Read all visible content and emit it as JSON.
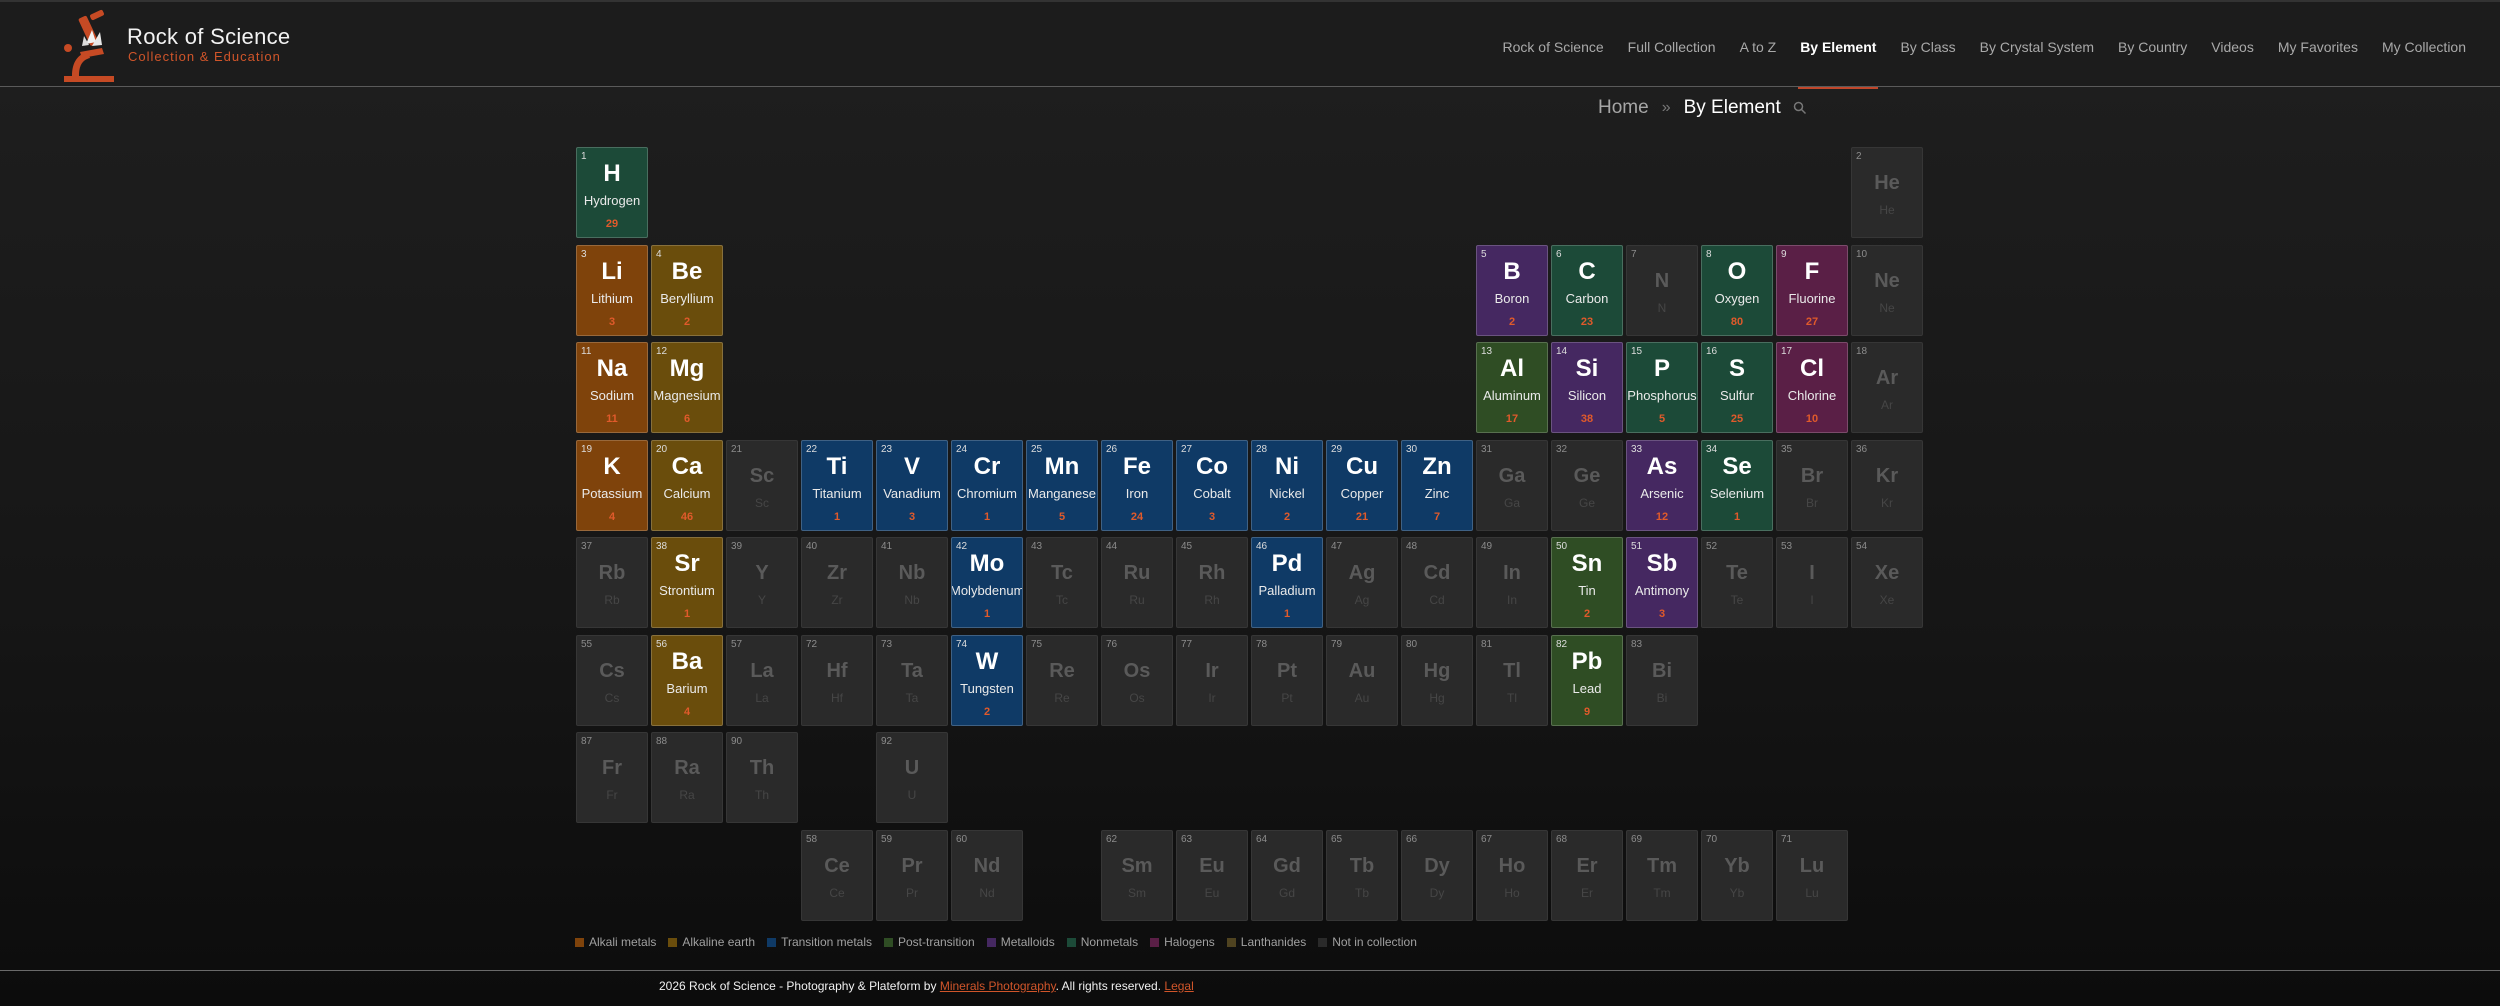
{
  "header": {
    "logo_title": "Rock of Science",
    "logo_subtitle": "Collection & Education",
    "logo_icon": "microscope-crystal-icon",
    "accent_color": "#d0552a",
    "nav": [
      {
        "label": "Rock of Science",
        "active": false
      },
      {
        "label": "Full Collection",
        "active": false
      },
      {
        "label": "A to Z",
        "active": false
      },
      {
        "label": "By Element",
        "active": true
      },
      {
        "label": "By Class",
        "active": false
      },
      {
        "label": "By Crystal System",
        "active": false
      },
      {
        "label": "By Country",
        "active": false
      },
      {
        "label": "Videos",
        "active": false
      },
      {
        "label": "My Favorites",
        "active": false
      },
      {
        "label": "My Collection",
        "active": false
      }
    ]
  },
  "breadcrumb": {
    "home": "Home",
    "separator": "»",
    "current": "By Element",
    "search_icon": "search-icon"
  },
  "category_colors": {
    "alkali": "#7f430b",
    "alkaline": "#6a4d0c",
    "transition": "#0f3a66",
    "post": "#2f4d24",
    "metalloid": "#452861",
    "nonmetal": "#1c4a38",
    "halogen": "#5a1f46",
    "lanth": "#4f4320",
    "none": "#2a2a2a"
  },
  "elements": [
    {
      "num": "1",
      "sym": "H",
      "name": "Hydrogen",
      "count": "29",
      "cat": "nonmetal"
    },
    {
      "num": "2",
      "sym": "He",
      "name": "He",
      "count": "",
      "cat": "none"
    },
    {
      "num": "3",
      "sym": "Li",
      "name": "Lithium",
      "count": "3",
      "cat": "alkali"
    },
    {
      "num": "4",
      "sym": "Be",
      "name": "Beryllium",
      "count": "2",
      "cat": "alkaline"
    },
    {
      "num": "5",
      "sym": "B",
      "name": "Boron",
      "count": "2",
      "cat": "metalloid"
    },
    {
      "num": "6",
      "sym": "C",
      "name": "Carbon",
      "count": "23",
      "cat": "nonmetal"
    },
    {
      "num": "7",
      "sym": "N",
      "name": "N",
      "count": "",
      "cat": "none"
    },
    {
      "num": "8",
      "sym": "O",
      "name": "Oxygen",
      "count": "80",
      "cat": "nonmetal"
    },
    {
      "num": "9",
      "sym": "F",
      "name": "Fluorine",
      "count": "27",
      "cat": "halogen"
    },
    {
      "num": "10",
      "sym": "Ne",
      "name": "Ne",
      "count": "",
      "cat": "none"
    },
    {
      "num": "11",
      "sym": "Na",
      "name": "Sodium",
      "count": "11",
      "cat": "alkali"
    },
    {
      "num": "12",
      "sym": "Mg",
      "name": "Magnesium",
      "count": "6",
      "cat": "alkaline"
    },
    {
      "num": "13",
      "sym": "Al",
      "name": "Aluminum",
      "count": "17",
      "cat": "post"
    },
    {
      "num": "14",
      "sym": "Si",
      "name": "Silicon",
      "count": "38",
      "cat": "metalloid"
    },
    {
      "num": "15",
      "sym": "P",
      "name": "Phosphorus",
      "count": "5",
      "cat": "nonmetal"
    },
    {
      "num": "16",
      "sym": "S",
      "name": "Sulfur",
      "count": "25",
      "cat": "nonmetal"
    },
    {
      "num": "17",
      "sym": "Cl",
      "name": "Chlorine",
      "count": "10",
      "cat": "halogen"
    },
    {
      "num": "18",
      "sym": "Ar",
      "name": "Ar",
      "count": "",
      "cat": "none"
    },
    {
      "num": "19",
      "sym": "K",
      "name": "Potassium",
      "count": "4",
      "cat": "alkali"
    },
    {
      "num": "20",
      "sym": "Ca",
      "name": "Calcium",
      "count": "46",
      "cat": "alkaline"
    },
    {
      "num": "21",
      "sym": "Sc",
      "name": "Sc",
      "count": "",
      "cat": "none"
    },
    {
      "num": "22",
      "sym": "Ti",
      "name": "Titanium",
      "count": "1",
      "cat": "transition"
    },
    {
      "num": "23",
      "sym": "V",
      "name": "Vanadium",
      "count": "3",
      "cat": "transition"
    },
    {
      "num": "24",
      "sym": "Cr",
      "name": "Chromium",
      "count": "1",
      "cat": "transition"
    },
    {
      "num": "25",
      "sym": "Mn",
      "name": "Manganese",
      "count": "5",
      "cat": "transition"
    },
    {
      "num": "26",
      "sym": "Fe",
      "name": "Iron",
      "count": "24",
      "cat": "transition"
    },
    {
      "num": "27",
      "sym": "Co",
      "name": "Cobalt",
      "count": "3",
      "cat": "transition"
    },
    {
      "num": "28",
      "sym": "Ni",
      "name": "Nickel",
      "count": "2",
      "cat": "transition"
    },
    {
      "num": "29",
      "sym": "Cu",
      "name": "Copper",
      "count": "21",
      "cat": "transition"
    },
    {
      "num": "30",
      "sym": "Zn",
      "name": "Zinc",
      "count": "7",
      "cat": "transition"
    },
    {
      "num": "31",
      "sym": "Ga",
      "name": "Ga",
      "count": "",
      "cat": "none"
    },
    {
      "num": "32",
      "sym": "Ge",
      "name": "Ge",
      "count": "",
      "cat": "none"
    },
    {
      "num": "33",
      "sym": "As",
      "name": "Arsenic",
      "count": "12",
      "cat": "metalloid"
    },
    {
      "num": "34",
      "sym": "Se",
      "name": "Selenium",
      "count": "1",
      "cat": "nonmetal"
    },
    {
      "num": "35",
      "sym": "Br",
      "name": "Br",
      "count": "",
      "cat": "none"
    },
    {
      "num": "36",
      "sym": "Kr",
      "name": "Kr",
      "count": "",
      "cat": "none"
    },
    {
      "num": "37",
      "sym": "Rb",
      "name": "Rb",
      "count": "",
      "cat": "none"
    },
    {
      "num": "38",
      "sym": "Sr",
      "name": "Strontium",
      "count": "1",
      "cat": "alkaline"
    },
    {
      "num": "39",
      "sym": "Y",
      "name": "Y",
      "count": "",
      "cat": "none"
    },
    {
      "num": "40",
      "sym": "Zr",
      "name": "Zr",
      "count": "",
      "cat": "none"
    },
    {
      "num": "41",
      "sym": "Nb",
      "name": "Nb",
      "count": "",
      "cat": "none"
    },
    {
      "num": "42",
      "sym": "Mo",
      "name": "Molybdenum",
      "count": "1",
      "cat": "transition"
    },
    {
      "num": "43",
      "sym": "Tc",
      "name": "Tc",
      "count": "",
      "cat": "none"
    },
    {
      "num": "44",
      "sym": "Ru",
      "name": "Ru",
      "count": "",
      "cat": "none"
    },
    {
      "num": "45",
      "sym": "Rh",
      "name": "Rh",
      "count": "",
      "cat": "none"
    },
    {
      "num": "46",
      "sym": "Pd",
      "name": "Palladium",
      "count": "1",
      "cat": "transition"
    },
    {
      "num": "47",
      "sym": "Ag",
      "name": "Ag",
      "count": "",
      "cat": "none"
    },
    {
      "num": "48",
      "sym": "Cd",
      "name": "Cd",
      "count": "",
      "cat": "none"
    },
    {
      "num": "49",
      "sym": "In",
      "name": "In",
      "count": "",
      "cat": "none"
    },
    {
      "num": "50",
      "sym": "Sn",
      "name": "Tin",
      "count": "2",
      "cat": "post"
    },
    {
      "num": "51",
      "sym": "Sb",
      "name": "Antimony",
      "count": "3",
      "cat": "metalloid"
    },
    {
      "num": "52",
      "sym": "Te",
      "name": "Te",
      "count": "",
      "cat": "none"
    },
    {
      "num": "53",
      "sym": "I",
      "name": "I",
      "count": "",
      "cat": "none"
    },
    {
      "num": "54",
      "sym": "Xe",
      "name": "Xe",
      "count": "",
      "cat": "none"
    },
    {
      "num": "55",
      "sym": "Cs",
      "name": "Cs",
      "count": "",
      "cat": "none"
    },
    {
      "num": "56",
      "sym": "Ba",
      "name": "Barium",
      "count": "4",
      "cat": "alkaline"
    },
    {
      "num": "57",
      "sym": "La",
      "name": "La",
      "count": "",
      "cat": "none"
    },
    {
      "num": "72",
      "sym": "Hf",
      "name": "Hf",
      "count": "",
      "cat": "none"
    },
    {
      "num": "73",
      "sym": "Ta",
      "name": "Ta",
      "count": "",
      "cat": "none"
    },
    {
      "num": "74",
      "sym": "W",
      "name": "Tungsten",
      "count": "2",
      "cat": "transition"
    },
    {
      "num": "75",
      "sym": "Re",
      "name": "Re",
      "count": "",
      "cat": "none"
    },
    {
      "num": "76",
      "sym": "Os",
      "name": "Os",
      "count": "",
      "cat": "none"
    },
    {
      "num": "77",
      "sym": "Ir",
      "name": "Ir",
      "count": "",
      "cat": "none"
    },
    {
      "num": "78",
      "sym": "Pt",
      "name": "Pt",
      "count": "",
      "cat": "none"
    },
    {
      "num": "79",
      "sym": "Au",
      "name": "Au",
      "count": "",
      "cat": "none"
    },
    {
      "num": "80",
      "sym": "Hg",
      "name": "Hg",
      "count": "",
      "cat": "none"
    },
    {
      "num": "81",
      "sym": "Tl",
      "name": "Tl",
      "count": "",
      "cat": "none"
    },
    {
      "num": "82",
      "sym": "Pb",
      "name": "Lead",
      "count": "9",
      "cat": "post"
    },
    {
      "num": "83",
      "sym": "Bi",
      "name": "Bi",
      "count": "",
      "cat": "none"
    },
    {
      "num": "87",
      "sym": "Fr",
      "name": "Fr",
      "count": "",
      "cat": "none"
    },
    {
      "num": "88",
      "sym": "Ra",
      "name": "Ra",
      "count": "",
      "cat": "none"
    },
    {
      "num": "90",
      "sym": "Th",
      "name": "Th",
      "count": "",
      "cat": "none"
    },
    {
      "num": "92",
      "sym": "U",
      "name": "U",
      "count": "",
      "cat": "none"
    },
    {
      "num": "58",
      "sym": "Ce",
      "name": "Ce",
      "count": "",
      "cat": "none"
    },
    {
      "num": "59",
      "sym": "Pr",
      "name": "Pr",
      "count": "",
      "cat": "none"
    },
    {
      "num": "60",
      "sym": "Nd",
      "name": "Nd",
      "count": "",
      "cat": "none"
    },
    {
      "num": "62",
      "sym": "Sm",
      "name": "Sm",
      "count": "",
      "cat": "none"
    },
    {
      "num": "63",
      "sym": "Eu",
      "name": "Eu",
      "count": "",
      "cat": "none"
    },
    {
      "num": "64",
      "sym": "Gd",
      "name": "Gd",
      "count": "",
      "cat": "none"
    },
    {
      "num": "65",
      "sym": "Tb",
      "name": "Tb",
      "count": "",
      "cat": "none"
    },
    {
      "num": "66",
      "sym": "Dy",
      "name": "Dy",
      "count": "",
      "cat": "none"
    },
    {
      "num": "67",
      "sym": "Ho",
      "name": "Ho",
      "count": "",
      "cat": "none"
    },
    {
      "num": "68",
      "sym": "Er",
      "name": "Er",
      "count": "",
      "cat": "none"
    },
    {
      "num": "69",
      "sym": "Tm",
      "name": "Tm",
      "count": "",
      "cat": "none"
    },
    {
      "num": "70",
      "sym": "Yb",
      "name": "Yb",
      "count": "",
      "cat": "none"
    },
    {
      "num": "71",
      "sym": "Lu",
      "name": "Lu",
      "count": "",
      "cat": "none"
    }
  ],
  "legend": [
    {
      "label": "Alkali metals",
      "cat": "alkali"
    },
    {
      "label": "Alkaline earth",
      "cat": "alkaline"
    },
    {
      "label": "Transition metals",
      "cat": "transition"
    },
    {
      "label": "Post-transition",
      "cat": "post"
    },
    {
      "label": "Metalloids",
      "cat": "metalloid"
    },
    {
      "label": "Nonmetals",
      "cat": "nonmetal"
    },
    {
      "label": "Halogens",
      "cat": "halogen"
    },
    {
      "label": "Lanthanides",
      "cat": "lanth"
    },
    {
      "label": "Not in collection",
      "cat": "none"
    }
  ],
  "footer": {
    "prefix": "2026 Rock of Science - Photography & Plateform by",
    "link": "Minerals Photography",
    "middle": ". All rights reserved.",
    "legal": "Legal"
  }
}
